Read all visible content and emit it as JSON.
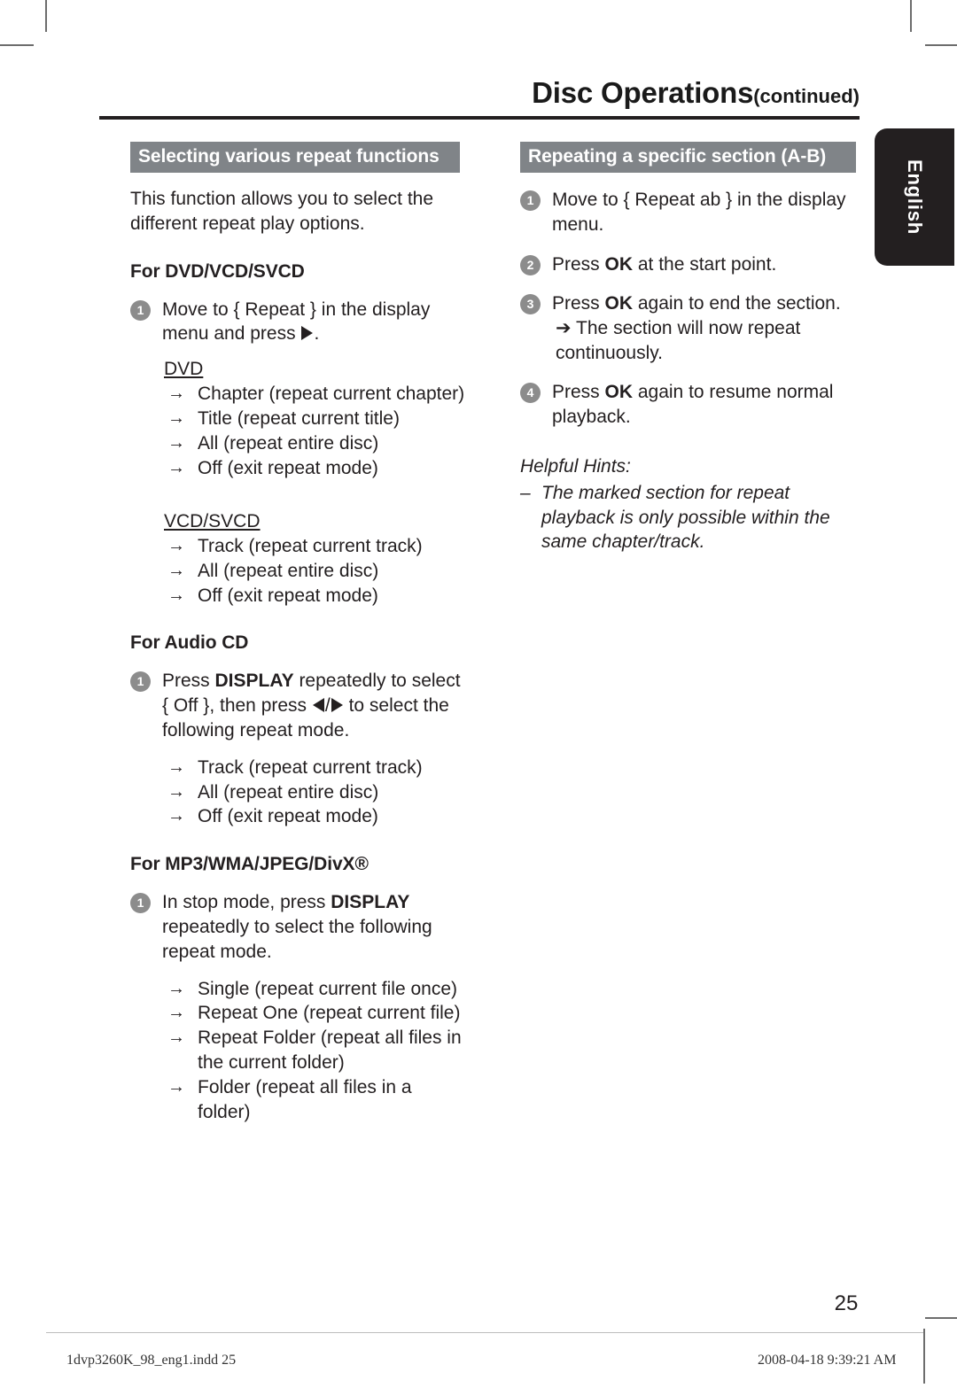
{
  "header": {
    "title": "Disc Operations",
    "continued": "(continued)"
  },
  "language_tab": {
    "label": "English"
  },
  "left_column": {
    "section_title": "Selecting various repeat functions",
    "intro": "This function allows you to select the different repeat play options.",
    "dvd_group": {
      "heading": "For DVD/VCD/SVCD",
      "step1_prefix": "Move to { Repeat } in the display menu and press ",
      "step1_suffix": ".",
      "step1_number": "1",
      "dvd_label": "DVD",
      "dvd_options": [
        "Chapter (repeat current chapter)",
        "Title (repeat current title)",
        "All (repeat entire disc)",
        "Off (exit repeat mode)"
      ],
      "vcd_label": "VCD/SVCD",
      "vcd_options": [
        "Track (repeat current track)",
        "All (repeat entire disc)",
        "Off (exit repeat mode)"
      ]
    },
    "audio_cd_group": {
      "heading": "For Audio CD",
      "step1_number": "1",
      "step1_part1": "Press ",
      "step1_bold1": "DISPLAY",
      "step1_part2": " repeatedly to select { Off }, then press ",
      "step1_part3": " to select the following repeat mode.",
      "options": [
        "Track (repeat current track)",
        "All (repeat entire disc)",
        "Off (exit repeat mode)"
      ]
    },
    "mp3_group": {
      "heading": "For MP3/WMA/JPEG/DivX®",
      "step1_number": "1",
      "step1_part1": "In stop mode, press ",
      "step1_bold1": "DISPLAY",
      "step1_part2": " repeatedly to select  the following repeat mode.",
      "options": [
        "Single (repeat current file once)",
        "Repeat One (repeat current file)",
        "Repeat Folder (repeat all files in the current folder)",
        "Folder (repeat all files in a folder)"
      ]
    }
  },
  "right_column": {
    "section_title": "Repeating a specific section (A-B)",
    "steps": [
      {
        "number": "1",
        "text": "Move to { Repeat ab } in the display menu."
      },
      {
        "number": "2",
        "part1": "Press ",
        "bold": "OK",
        "part2": " at the start point."
      },
      {
        "number": "3",
        "part1": "Press ",
        "bold": "OK",
        "part2": " again to end the section.",
        "sub": "➔ The section will now repeat continuously."
      },
      {
        "number": "4",
        "part1": "Press ",
        "bold": "OK",
        "part2": " again to resume normal playback."
      }
    ],
    "hints_title": "Helpful Hints:",
    "hints": [
      "The marked section for repeat playback is only possible within the same chapter/track."
    ]
  },
  "footer": {
    "page_number": "25",
    "file_name": "1dvp3260K_98_eng1.indd   25",
    "timestamp": "2008-04-18   9:39:21 AM"
  },
  "colors": {
    "section_bar": "#808488",
    "tab_background": "#231f20",
    "step_bullet": "#8c8c8c",
    "text": "#231f20"
  }
}
